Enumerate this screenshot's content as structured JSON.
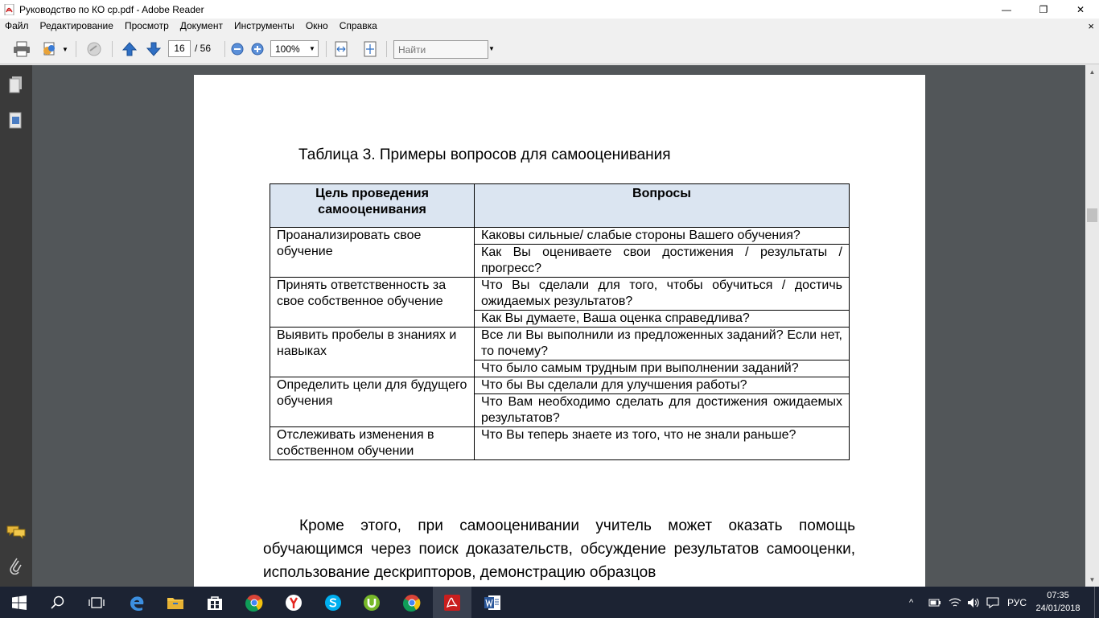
{
  "window": {
    "title": "Руководство по КО ср.pdf - Adobe Reader",
    "minimize": "—",
    "maximize": "❐",
    "close": "✕"
  },
  "menu": {
    "items": [
      "Файл",
      "Редактирование",
      "Просмотр",
      "Документ",
      "Инструменты",
      "Окно",
      "Справка"
    ],
    "close": "×"
  },
  "toolbar": {
    "page_current": "16",
    "page_total": "/ 56",
    "zoom": "100%",
    "find_placeholder": "Найти"
  },
  "document": {
    "caption": "Таблица 3. Примеры вопросов для самооценивания",
    "table": {
      "headers": [
        "Цель проведения самооценивания",
        "Вопросы"
      ],
      "groups": [
        {
          "goal": "Проанализировать свое обучение",
          "questions": [
            "Каковы сильные/ слабые стороны Вашего обучения?",
            "Как Вы оцениваете свои достижения / результаты / прогресс?"
          ]
        },
        {
          "goal": "Принять ответственность за свое собственное обучение",
          "questions": [
            "Что Вы сделали для того, чтобы обучиться / достичь ожидаемых результатов?",
            "Как Вы думаете, Ваша оценка справедлива?"
          ]
        },
        {
          "goal": "Выявить пробелы в знаниях и навыках",
          "questions": [
            "Все ли Вы выполнили из предложенных заданий? Если нет, то почему?",
            "Что было самым трудным при выполнении заданий?"
          ]
        },
        {
          "goal": "Определить цели для будущего обучения",
          "questions": [
            "Что бы Вы сделали для улучшения работы?",
            "Что Вам необходимо сделать для достижения ожидаемых результатов?"
          ]
        },
        {
          "goal": "Отслеживать изменения в собственном обучении",
          "questions": [
            "Что Вы теперь знаете из того, что не знали раньше?"
          ]
        }
      ]
    },
    "paragraph": "Кроме этого, при самооценивании учитель может оказать помощь обучающимся через поиск доказательств, обсуждение результатов самооценки, использование дескрипторов, демонстрацию образцов"
  },
  "taskbar": {
    "apps": [
      "start-icon",
      "search-icon",
      "task-view-icon",
      "edge-icon",
      "file-explorer-icon",
      "store-icon",
      "chrome-icon",
      "yandex-browser-icon",
      "skype-icon",
      "utorrent-icon",
      "chrome-icon",
      "adobe-reader-icon",
      "word-icon"
    ],
    "language": "РУС",
    "time": "07:35",
    "date": "24/01/2018"
  },
  "colors": {
    "nav_panel": "#3a3a3a",
    "doc_background": "#525659",
    "table_header": "#dbe5f1",
    "taskbar": "#1c2333"
  }
}
